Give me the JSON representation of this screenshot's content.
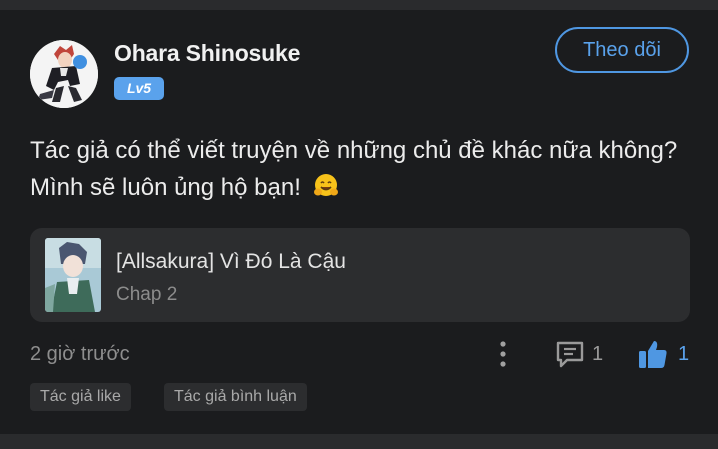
{
  "comment": {
    "author": {
      "name": "Ohara Shinosuke",
      "level": "Lv5",
      "avatar_icon": "anime-character-avatar"
    },
    "follow_label": "Theo dõi",
    "text": "Tác giả có thể viết truyện về những chủ đề khác nữa không? Mình sẽ luôn ủng hộ bạn!",
    "emoji": "hugging-face-emoji",
    "story": {
      "title": "[Allsakura] Vì Đó Là Cậu",
      "chapter": "Chap 2",
      "cover_icon": "manga-cover-thumbnail"
    },
    "timestamp": "2 giờ trước",
    "reply_count": "1",
    "like_count": "1",
    "tags": [
      "Tác giả like",
      "Tác giả bình luận"
    ]
  },
  "colors": {
    "background": "#1b1c1e",
    "accent": "#5aa2ec",
    "card": "#2c2d2f",
    "divider": "#2a2b2d"
  }
}
